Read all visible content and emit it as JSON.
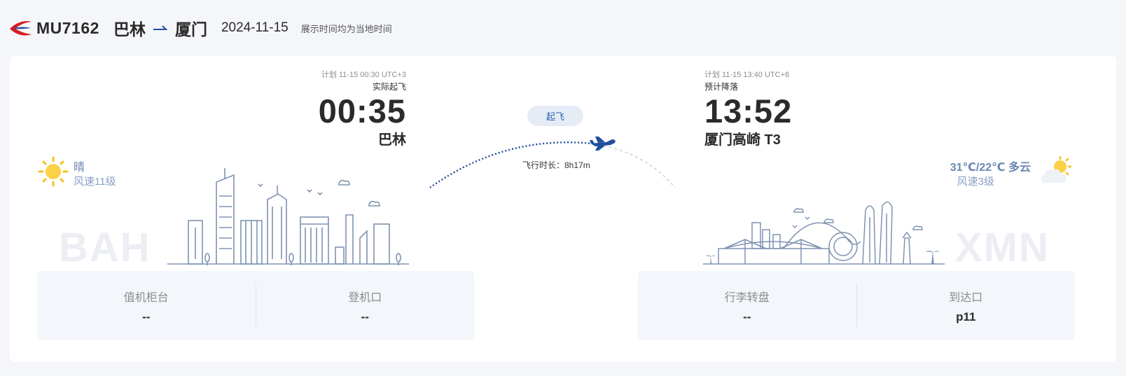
{
  "header": {
    "flight_no": "MU7162",
    "origin_city": "巴林",
    "dest_city": "厦门",
    "date": "2024-11-15",
    "note": "展示时间均为当地时间"
  },
  "departure": {
    "plan": "计划 11-15 00:30 UTC+3",
    "status": "实际起飞",
    "time": "00:35",
    "airport": "巴林",
    "code": "BAH",
    "weather": {
      "icon": "sun-icon",
      "condition": "晴",
      "wind": "风速11级"
    }
  },
  "arrival": {
    "plan": "计划 11-15 13:40 UTC+8",
    "status": "预计降落",
    "time": "13:52",
    "airport": "厦门高崎 T3",
    "code": "XMN",
    "weather": {
      "icon": "partly-cloudy-icon",
      "condition": "31℃/22℃ 多云",
      "wind": "风速3级"
    }
  },
  "flight": {
    "status_label": "起飞",
    "duration": "飞行时长：8h17m"
  },
  "departure_info": [
    {
      "label": "值机柜台",
      "value": "--"
    },
    {
      "label": "登机口",
      "value": "--"
    }
  ],
  "arrival_info": [
    {
      "label": "行李转盘",
      "value": "--"
    },
    {
      "label": "到达口",
      "value": "p11"
    }
  ],
  "colors": {
    "brand_red": "#d71a21",
    "brand_blue": "#1f4f9c",
    "accent_blue": "#2a63b0",
    "skyline": "#7f93b2"
  }
}
